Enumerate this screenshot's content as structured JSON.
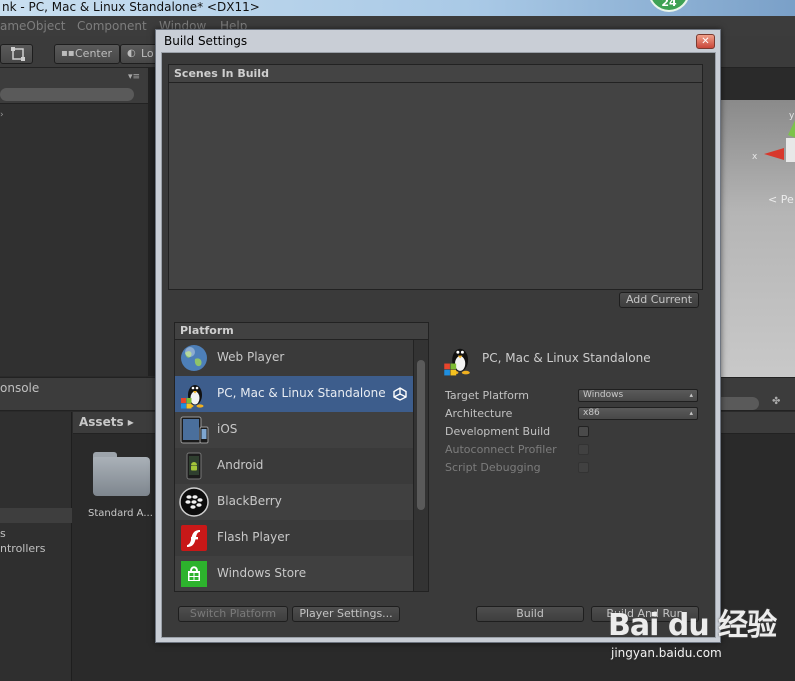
{
  "window": {
    "title": "nk - PC, Mac & Linux Standalone* <DX11>",
    "badge": "24"
  },
  "menu": [
    "ameObject",
    "Component",
    "Window",
    "Help"
  ],
  "toolbar": {
    "pivot_label": "Center",
    "handle_label": "Lo"
  },
  "scene": {
    "persp_label": "< Pe"
  },
  "bottom": {
    "console_tab": "onsole",
    "assets_label": "Assets ▸",
    "left_items": [
      "s",
      "ntrollers"
    ],
    "folder_label": "Standard A..."
  },
  "dialog": {
    "title": "Build Settings",
    "scenes_header": "Scenes In Build",
    "add_current_label": "Add Current",
    "platform_header": "Platform",
    "platforms": [
      {
        "label": "Web Player",
        "icon": "globe-icon"
      },
      {
        "label": "PC, Mac & Linux Standalone",
        "icon": "tux-icon",
        "selected": true
      },
      {
        "label": "iOS",
        "icon": "ipad-icon"
      },
      {
        "label": "Android",
        "icon": "android-icon"
      },
      {
        "label": "BlackBerry",
        "icon": "blackberry-icon"
      },
      {
        "label": "Flash Player",
        "icon": "flash-icon"
      },
      {
        "label": "Windows Store",
        "icon": "windows-store-icon"
      }
    ],
    "selected_platform_title": "PC, Mac & Linux Standalone",
    "options": {
      "target_platform_label": "Target Platform",
      "target_platform_value": "Windows",
      "architecture_label": "Architecture",
      "architecture_value": "x86",
      "development_build_label": "Development Build",
      "autoconnect_profiler_label": "Autoconnect Profiler",
      "script_debugging_label": "Script Debugging"
    },
    "buttons": {
      "switch_platform": "Switch Platform",
      "player_settings": "Player Settings...",
      "build": "Build",
      "build_and_run": "Build And Run"
    }
  },
  "watermark": {
    "brand": "Bai du 经验",
    "url": "jingyan.baidu.com"
  },
  "colors": {
    "selection": "#3d5d8c",
    "panel": "#3a3a3a",
    "dialog_frame": "#c9ced6"
  }
}
